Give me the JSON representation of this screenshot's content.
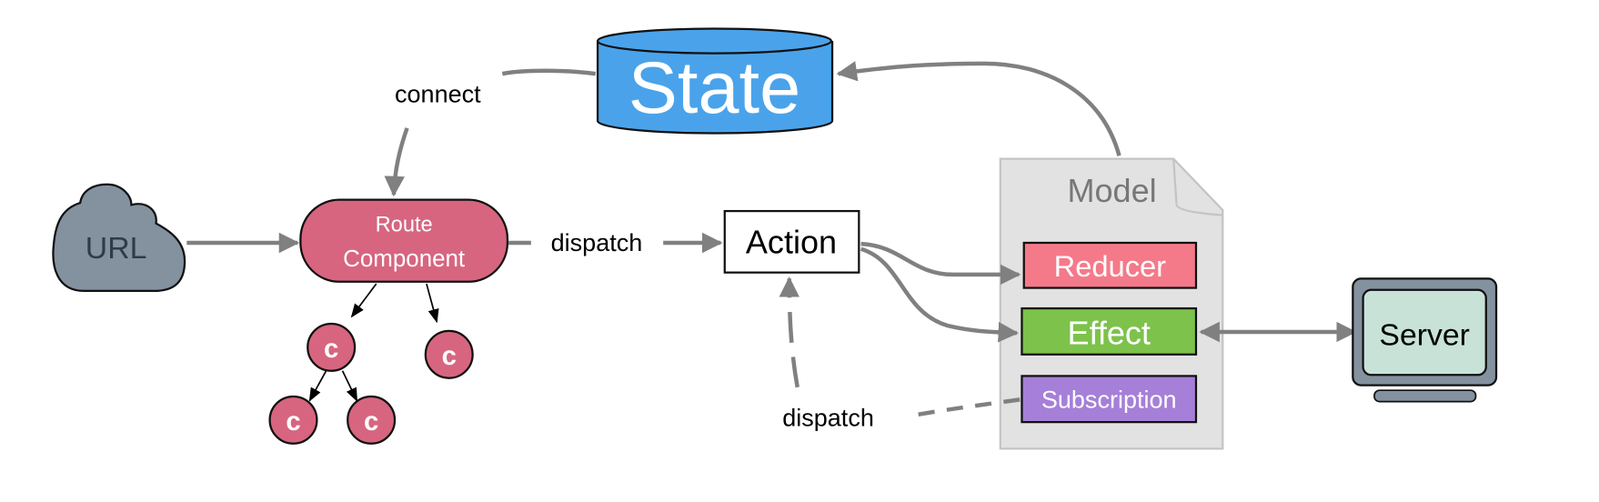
{
  "nodes": {
    "state": "State",
    "url": "URL",
    "route_line1": "Route",
    "route_line2": "Component",
    "action": "Action",
    "model": "Model",
    "reducer": "Reducer",
    "effect": "Effect",
    "subscription": "Subscription",
    "server": "Server",
    "child": "c"
  },
  "edges": {
    "connect": "connect",
    "dispatch_top": "dispatch",
    "dispatch_bottom": "dispatch"
  },
  "colors": {
    "state": "#4aa3ea",
    "url": "#84919f",
    "route": "#d76580",
    "reducer": "#f47a8a",
    "effect": "#7dc24b",
    "subscription": "#a67fd8",
    "model": "#e2e2e2",
    "server_screen": "#c8e2d8",
    "server_frame": "#84919f",
    "arrow": "#808080"
  }
}
